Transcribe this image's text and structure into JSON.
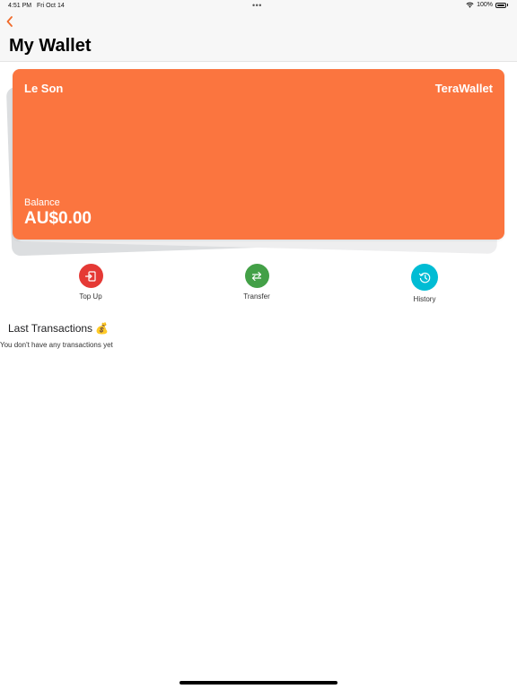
{
  "status_bar": {
    "time": "4:51 PM",
    "date": "Fri Oct 14",
    "battery": "100%"
  },
  "header": {
    "title": "My Wallet"
  },
  "card": {
    "holder": "Le Son",
    "brand": "TeraWallet",
    "balance_label": "Balance",
    "balance": "AU$0.00"
  },
  "actions": [
    {
      "label": "Top Up",
      "icon": "top-up-icon",
      "color": "#e53935"
    },
    {
      "label": "Transfer",
      "icon": "transfer-icon",
      "color": "#43a047"
    },
    {
      "label": "History",
      "icon": "history-icon",
      "color": "#00bcd4"
    }
  ],
  "transactions": {
    "title": "Last Transactions 💰",
    "empty_text": "You don't have any transactions yet"
  },
  "colors": {
    "accent": "#fb753f",
    "back": "#f06a2a"
  }
}
